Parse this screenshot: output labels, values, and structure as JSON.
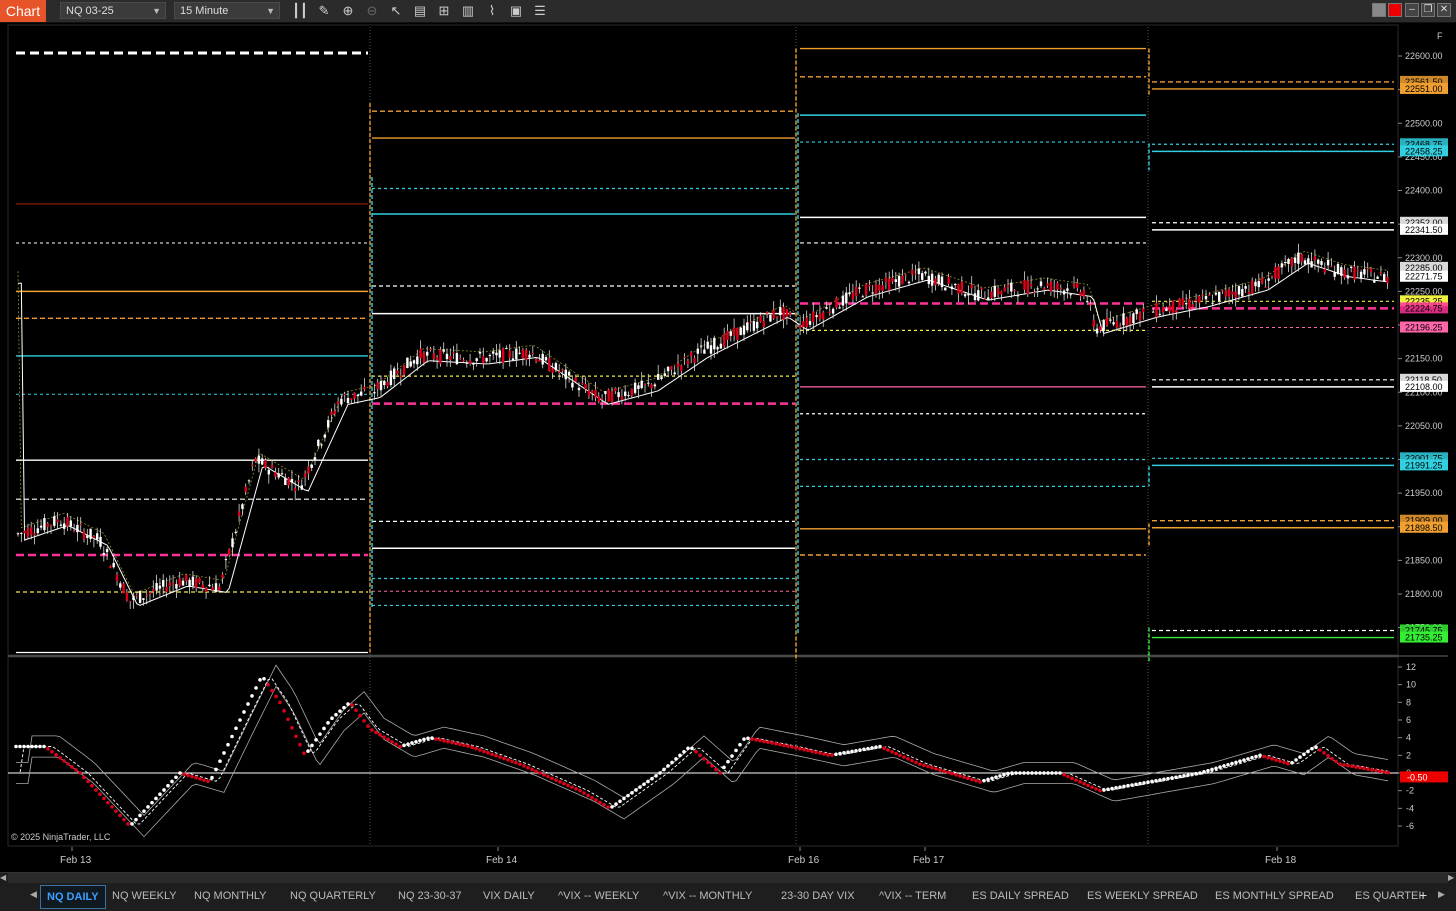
{
  "toolbar": {
    "chart_tab": "Chart",
    "instrument": "NQ 03-25",
    "interval": "15 Minute",
    "icons": [
      "bar-type-icon",
      "pencil-icon",
      "zoom-in-icon",
      "zoom-out-icon",
      "pointer-icon",
      "data-box-icon",
      "properties-icon",
      "strategies-icon",
      "indicators-icon",
      "templates-icon",
      "list-icon"
    ]
  },
  "colors": {
    "orange": "#f0a030",
    "cyan": "#30d0e0",
    "white": "#ffffff",
    "magenta": "#ff3399",
    "yellow": "#f0f040",
    "pink": "#ff66aa",
    "green": "#33ee33",
    "darkred": "#a02010",
    "red_candle": "#e0001a",
    "background": "#000000"
  },
  "chart_data": [
    {
      "type": "candlestick",
      "title": "",
      "price_ticks": [
        "22600.00",
        "22550.00",
        "22500.00",
        "22450.00",
        "22400.00",
        "22350.00",
        "22300.00",
        "22250.00",
        "22200.00",
        "22150.00",
        "22100.00",
        "22050.00",
        "22000.00",
        "21950.00",
        "21900.00",
        "21850.00",
        "21800.00",
        "21750.00"
      ],
      "ylim": [
        21705,
        22625
      ],
      "price_labels": [
        {
          "text": "22561.50",
          "color": "#f0a030",
          "ghost": true
        },
        {
          "text": "22551.00",
          "color": "#f0a030",
          "ghost": false
        },
        {
          "text": "22468.75",
          "color": "#30d0e0",
          "ghost": true
        },
        {
          "text": "22458.25",
          "color": "#30d0e0",
          "ghost": false
        },
        {
          "text": "22352.00",
          "color": "#ffffff",
          "ghost": true
        },
        {
          "text": "22341.50",
          "color": "#ffffff",
          "ghost": false
        },
        {
          "text": "22285.00",
          "color": "#ffffff",
          "ghost": true
        },
        {
          "text": "22271.75",
          "color": "#ffffff",
          "ghost": false
        },
        {
          "text": "22235.25",
          "color": "#f0f040",
          "ghost": false
        },
        {
          "text": "22224.75",
          "color": "#ff3399",
          "ghost": true
        },
        {
          "text": "22196.25",
          "color": "#ff66aa",
          "ghost": false
        },
        {
          "text": "22118.50",
          "color": "#ffffff",
          "ghost": true
        },
        {
          "text": "22108.00",
          "color": "#ffffff",
          "ghost": false
        },
        {
          "text": "22001.75",
          "color": "#30d0e0",
          "ghost": true
        },
        {
          "text": "21991.25",
          "color": "#30d0e0",
          "ghost": false
        },
        {
          "text": "21909.00",
          "color": "#f0a030",
          "ghost": true
        },
        {
          "text": "21898.50",
          "color": "#f0a030",
          "ghost": false
        },
        {
          "text": "21745.75",
          "color": "#33ee33",
          "ghost": true
        },
        {
          "text": "21735.25",
          "color": "#33ee33",
          "ghost": false
        }
      ]
    },
    {
      "type": "line",
      "title": "",
      "osc_ticks": [
        "12",
        "10",
        "8",
        "6",
        "4",
        "2",
        "0",
        "-2",
        "-4",
        "-6"
      ],
      "ylim": [
        -7.5,
        13
      ],
      "current_value": "-0.50"
    }
  ],
  "x_ticks": [
    "Feb 13",
    "Feb 14",
    "Feb 16",
    "Feb 17",
    "Feb 18"
  ],
  "copyright": "© 2025 NinjaTrader, LLC",
  "tabs": [
    "NQ DAILY",
    "NQ WEEKLY",
    "NQ MONTHLY",
    "NQ QUARTERLY",
    "NQ 23-30-37",
    "VIX DAILY",
    "^VIX -- WEEKLY",
    "^VIX -- MONTHLY",
    "23-30 DAY VIX",
    "^VIX -- TERM",
    "ES DAILY SPREAD",
    "ES WEEKLY SPREAD",
    "ES MONTHLY SPREAD",
    "ES QUARTEI"
  ]
}
